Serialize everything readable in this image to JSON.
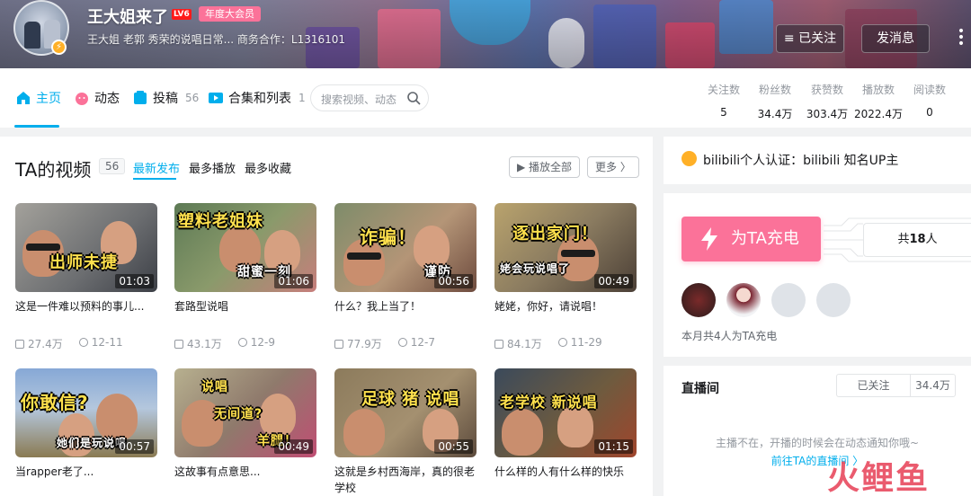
{
  "header": {
    "username": "王大姐来了",
    "level": "LV6",
    "vip_badge": "年度大会员",
    "signature": "王大姐 老郭 秀荣的说唱日常... 商务合作：L1316101",
    "follow_label": "≡ 已关注",
    "message_label": "发消息"
  },
  "nav": {
    "tabs": [
      {
        "label": "主页",
        "count": "",
        "icon": "home-icon"
      },
      {
        "label": "动态",
        "count": "",
        "icon": "dynamic-icon"
      },
      {
        "label": "投稿",
        "count": "56",
        "icon": "upload-icon"
      },
      {
        "label": "合集和列表",
        "count": "1",
        "icon": "collection-icon"
      }
    ],
    "search_placeholder": "搜索视频、动态",
    "stats": [
      {
        "label": "关注数",
        "value": "5"
      },
      {
        "label": "粉丝数",
        "value": "34.4万"
      },
      {
        "label": "获赞数",
        "value": "303.4万"
      },
      {
        "label": "播放数",
        "value": "2022.4万"
      },
      {
        "label": "阅读数",
        "value": "0"
      }
    ]
  },
  "videos": {
    "title": "TA的视频",
    "count": "56",
    "sort": [
      "最新发布",
      "最多播放",
      "最多收藏"
    ],
    "play_all": "▶ 播放全部",
    "more": "更多 〉",
    "items": [
      {
        "caption": "出师未捷",
        "duration": "01:03",
        "title": "这是一件难以预料的事儿...",
        "plays": "27.4万",
        "date": "12-11"
      },
      {
        "caption": "塑料老姐妹",
        "caption2": "甜蜜一刻",
        "duration": "01:06",
        "title": "套路型说唱",
        "plays": "43.1万",
        "date": "12-9"
      },
      {
        "caption": "诈骗！",
        "caption2": "谨防",
        "duration": "00:56",
        "title": "什么？我上当了！",
        "plays": "77.9万",
        "date": "12-7"
      },
      {
        "caption": "逐出家门！",
        "caption2": "姥会玩说唱了",
        "duration": "00:49",
        "title": "姥姥，你好，请说唱！",
        "plays": "84.1万",
        "date": "11-29"
      },
      {
        "caption": "你敢信?",
        "caption2": "她们是玩说唱",
        "duration": "00:57",
        "title": "当rapper老了...",
        "plays": "",
        "date": ""
      },
      {
        "caption": "说唱",
        "caption2": "无间道?",
        "caption3": "羊腿！",
        "duration": "00:49",
        "title": "这故事有点意思...",
        "plays": "",
        "date": ""
      },
      {
        "caption": "足球 猪 说唱",
        "duration": "00:55",
        "title": "这就是乡村西海岸，真的很老学校",
        "plays": "",
        "date": ""
      },
      {
        "caption": "老学校 新说唱",
        "duration": "01:15",
        "title": "什么样的人有什么样的快乐",
        "plays": "",
        "date": ""
      }
    ]
  },
  "sidebar": {
    "certification": "bilibili个人认证：bilibili 知名UP主",
    "charge_label": "为TA充电",
    "charge_total_prefix": "共",
    "charge_total": "18",
    "charge_total_suffix": "人",
    "charge_note": "本月共4人为TA充电",
    "live_title": "直播间",
    "live_follow": "已关注",
    "live_fans": "34.4万",
    "live_msg": "主播不在，开播的时候会在动态通知你哦~",
    "live_link": "前往TA的直播间 〉"
  },
  "watermark": "火鲤鱼",
  "colors": {
    "accent": "#00aeec",
    "pink": "#fb7299",
    "gold": "#ffb027"
  }
}
